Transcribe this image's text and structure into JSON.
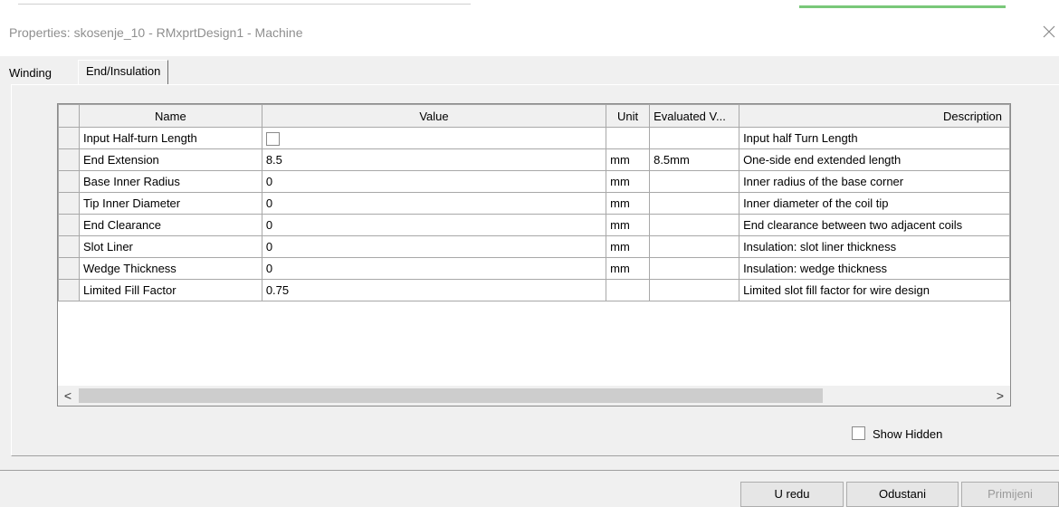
{
  "window": {
    "title": "Properties: skosenje_10 - RMxprtDesign1 - Machine",
    "close_icon": "close-icon"
  },
  "tabs": [
    {
      "label": "Winding",
      "active": false
    },
    {
      "label": "End/Insulation",
      "active": true
    }
  ],
  "table": {
    "columns": [
      "Name",
      "Value",
      "Unit",
      "Evaluated V...",
      "Description"
    ],
    "rows": [
      {
        "name": "Input Half-turn Length",
        "value": "",
        "value_type": "checkbox",
        "checked": false,
        "unit": "",
        "evaluated": "",
        "description": "Input half Turn Length"
      },
      {
        "name": "End Extension",
        "value": "8.5",
        "unit": "mm",
        "evaluated": "8.5mm",
        "description": "One-side end extended length"
      },
      {
        "name": "Base Inner Radius",
        "value": "0",
        "unit": "mm",
        "evaluated": "",
        "description": "Inner radius of the base corner"
      },
      {
        "name": "Tip Inner Diameter",
        "value": "0",
        "unit": "mm",
        "evaluated": "",
        "description": "Inner diameter of the coil tip"
      },
      {
        "name": "End Clearance",
        "value": "0",
        "unit": "mm",
        "evaluated": "",
        "description": "End clearance between two adjacent coils"
      },
      {
        "name": "Slot Liner",
        "value": "0",
        "unit": "mm",
        "evaluated": "",
        "description": "Insulation: slot liner thickness"
      },
      {
        "name": "Wedge Thickness",
        "value": "0",
        "unit": "mm",
        "evaluated": "",
        "description": "Insulation: wedge thickness"
      },
      {
        "name": "Limited Fill Factor",
        "value": "0.75",
        "unit": "",
        "evaluated": "",
        "description": "Limited slot fill factor for wire design"
      }
    ]
  },
  "scrollbar": {
    "left_arrow": "<",
    "right_arrow": ">"
  },
  "show_hidden": {
    "label": "Show Hidden",
    "checked": false
  },
  "buttons": {
    "ok": "U redu",
    "cancel": "Odustani",
    "apply": "Primijeni"
  }
}
